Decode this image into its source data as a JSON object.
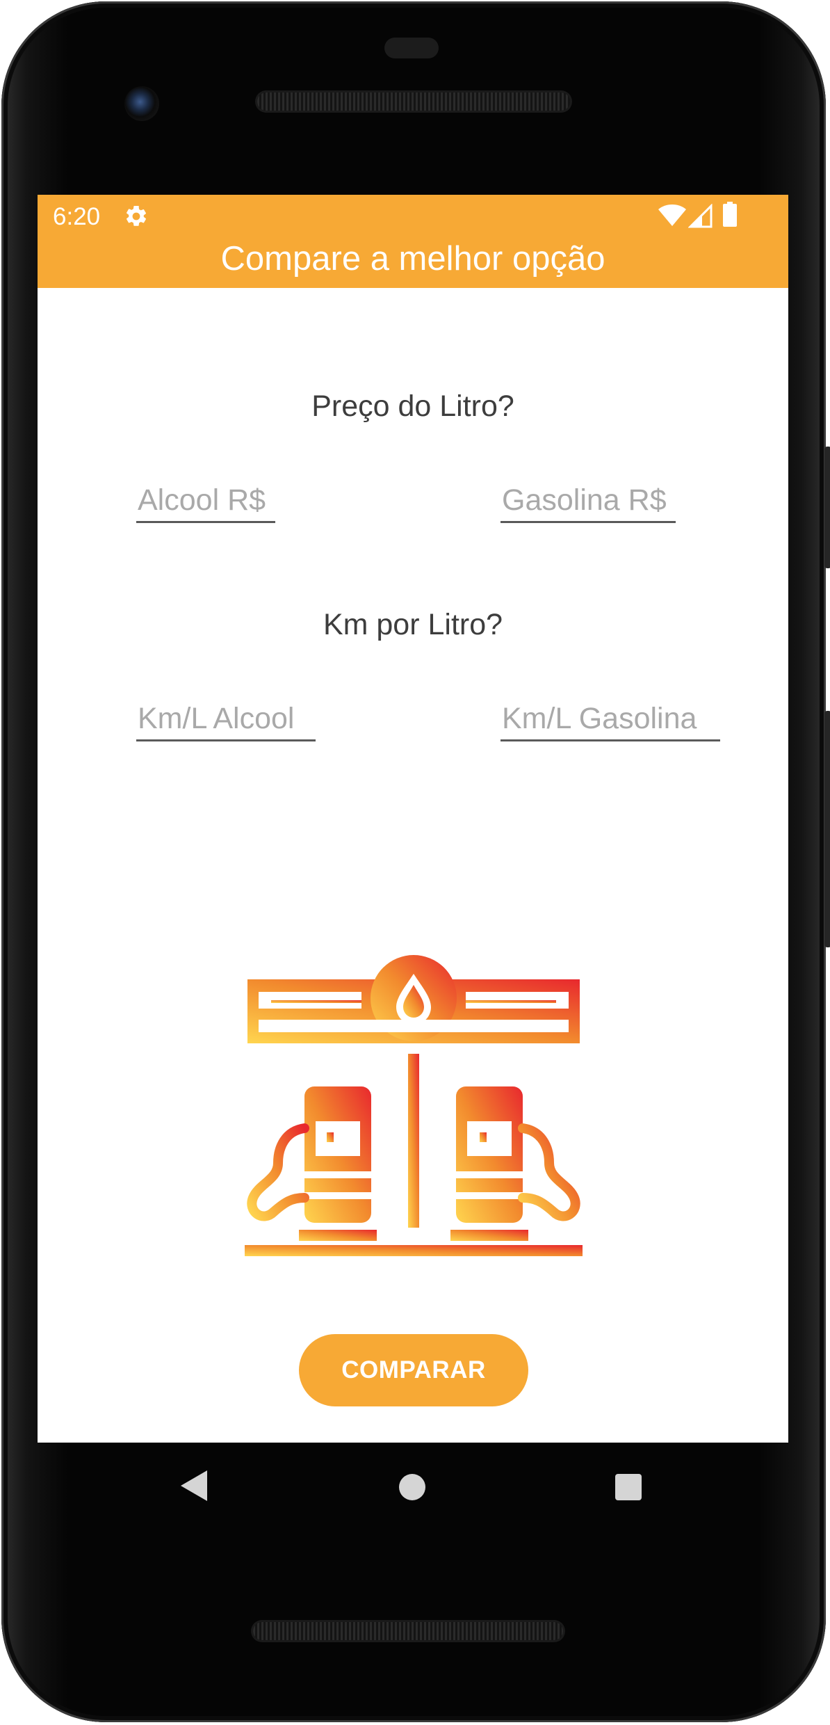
{
  "status_bar": {
    "time": "6:20",
    "icons": [
      "gear-icon",
      "wifi-icon",
      "signal-icon",
      "battery-icon"
    ]
  },
  "app_bar": {
    "title": "Compare a melhor opção"
  },
  "price_section": {
    "label": "Preço do Litro?",
    "alcool_field": {
      "placeholder": "Alcool R$",
      "value": ""
    },
    "gasolina_field": {
      "placeholder": "Gasolina R$",
      "value": ""
    }
  },
  "km_section": {
    "label": "Km por Litro?",
    "alcool_field": {
      "placeholder": "Km/L Alcool",
      "value": ""
    },
    "gasolina_field": {
      "placeholder": "Km/L Gasolina",
      "value": ""
    }
  },
  "illustration": {
    "icon": "gas-station-icon"
  },
  "compare_button": {
    "label": "COMPARAR"
  },
  "nav_bar": {
    "icons": [
      "back-icon",
      "home-icon",
      "recents-icon"
    ]
  },
  "colors": {
    "accent": "#f7a935",
    "text": "#3d3d3d",
    "placeholder": "#a9a9a9",
    "illustration_gradient": [
      "#ffd54f",
      "#f28b2e",
      "#e8282e"
    ]
  }
}
